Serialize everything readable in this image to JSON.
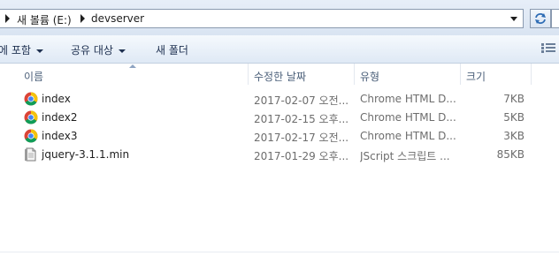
{
  "address_bar": {
    "crumbs": [
      "새 볼륨 (E:)",
      "devserver"
    ]
  },
  "toolbar": {
    "include_label": "에 포함",
    "share_label": "공유 대상",
    "new_folder_label": "새 폴더"
  },
  "columns": {
    "name": "이름",
    "date": "수정한 날짜",
    "type": "유형",
    "size": "크기"
  },
  "files": [
    {
      "name": "index",
      "date": "2017-02-07 오전...",
      "type": "Chrome HTML D...",
      "size": "7KB",
      "icon": "chrome-icon"
    },
    {
      "name": "index2",
      "date": "2017-02-15 오후...",
      "type": "Chrome HTML D...",
      "size": "5KB",
      "icon": "chrome-icon"
    },
    {
      "name": "index3",
      "date": "2017-02-17 오전...",
      "type": "Chrome HTML D...",
      "size": "3KB",
      "icon": "chrome-icon"
    },
    {
      "name": "jquery-3.1.1.min",
      "date": "2017-01-29 오후...",
      "type": "JScript 스크립트 ...",
      "size": "85KB",
      "icon": "script-file-icon"
    }
  ],
  "colors": {
    "chrome_red": "#db4437",
    "chrome_yellow": "#f4c20d",
    "chrome_green": "#0f9d58",
    "chrome_blue": "#4285f4"
  }
}
